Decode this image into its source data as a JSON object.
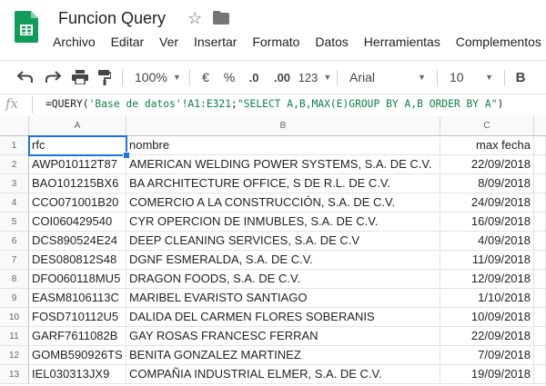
{
  "doc": {
    "title": "Funcion Query"
  },
  "menu": [
    "Archivo",
    "Editar",
    "Ver",
    "Insertar",
    "Formato",
    "Datos",
    "Herramientas",
    "Complementos"
  ],
  "toolbar": {
    "zoom": "100%",
    "currency": "€",
    "percent": "%",
    "dec_less": ".0",
    "dec_more": ".00",
    "more_formats": "123",
    "font": "Arial",
    "size": "10",
    "bold": "B"
  },
  "formula": {
    "fx": "fx",
    "prefix": "=QUERY(",
    "range": "'Base de datos'!A1:E321",
    "sep": ";",
    "query": "\"SELECT A,B,MAX(E)GROUP BY A,B ORDER BY A\"",
    "suffix": ")"
  },
  "columns": [
    "A",
    "B",
    "C"
  ],
  "rows": [
    {
      "n": "1",
      "a": "rfc",
      "b": "nombre",
      "c": "max fecha"
    },
    {
      "n": "2",
      "a": "AWP010112T87",
      "b": "AMERICAN WELDING POWER SYSTEMS, S.A. DE C.V.",
      "c": "22/09/2018"
    },
    {
      "n": "3",
      "a": "BAO101215BX6",
      "b": "BA ARCHITECTURE OFFICE, S DE R.L. DE C.V.",
      "c": "8/09/2018"
    },
    {
      "n": "4",
      "a": "CCO071001B20",
      "b": "COMERCIO A LA CONSTRUCCIÓN, S.A. DE C.V.",
      "c": "24/09/2018"
    },
    {
      "n": "5",
      "a": "COI060429540",
      "b": "CYR OPERCION DE INMUBLES, S.A. DE C.V.",
      "c": "16/09/2018"
    },
    {
      "n": "6",
      "a": "DCS890524E24",
      "b": "DEEP CLEANING SERVICES, S.A. DE C.V",
      "c": "4/09/2018"
    },
    {
      "n": "7",
      "a": "DES080812S48",
      "b": "DGNF ESMERALDA, S.A. DE C.V.",
      "c": "11/09/2018"
    },
    {
      "n": "8",
      "a": "DFO060118MU5",
      "b": "DRAGON FOODS, S.A. DE C.V.",
      "c": "12/09/2018"
    },
    {
      "n": "9",
      "a": "EASM8106113C",
      "b": "MARIBEL EVARISTO SANTIAGO",
      "c": "1/10/2018"
    },
    {
      "n": "10",
      "a": "FOSD710112U5",
      "b": "DALIDA DEL CARMEN FLORES SOBERANIS",
      "c": "10/09/2018"
    },
    {
      "n": "11",
      "a": "GARF7611082B",
      "b": "GAY ROSAS FRANCESC FERRAN",
      "c": "22/09/2018"
    },
    {
      "n": "12",
      "a": "GOMB590926TS",
      "b": "BENITA GONZALEZ MARTINEZ",
      "c": "7/09/2018"
    },
    {
      "n": "13",
      "a": "IEL030313JX9",
      "b": "COMPAÑIA INDUSTRIAL ELMER, S.A. DE C.V.",
      "c": "19/09/2018"
    }
  ]
}
